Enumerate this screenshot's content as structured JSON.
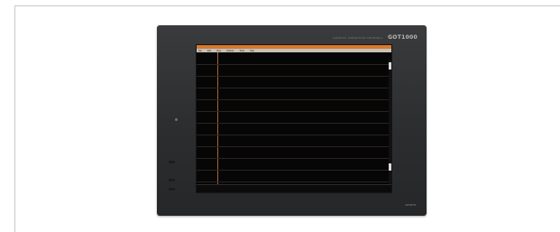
{
  "device": {
    "brand": "GOT1000",
    "brand_tag": "GRAPHIC OPERATION TERMINAL",
    "model": "GT1675"
  },
  "app": {
    "title_segments": [
      "",
      "",
      "",
      ""
    ],
    "menu": [
      "File",
      "Edit",
      "View",
      "Options",
      "Tools",
      "Help"
    ]
  },
  "screen": {
    "side_tag": "",
    "rows": [
      {
        "num": "",
        "tag": "",
        "v1": "",
        "v2": "",
        "v3": "",
        "v4": ""
      },
      {
        "num": "",
        "tag": "",
        "v1": "",
        "v2": "",
        "v3": "",
        "v4": ""
      },
      {
        "num": "",
        "tag": "",
        "v1": "",
        "v2": "",
        "v3": "",
        "v4": ""
      },
      {
        "num": "",
        "tag": "",
        "v1": "",
        "v2": "",
        "v3": "",
        "v4": ""
      },
      {
        "num": "",
        "tag": "",
        "v1": "",
        "v2": "",
        "v3": "",
        "v4": ""
      },
      {
        "num": "",
        "tag": "",
        "v1": "",
        "v2": "",
        "v3": "",
        "v4": ""
      },
      {
        "num": "",
        "tag": "",
        "v1": "",
        "v2": "",
        "v3": "",
        "v4": ""
      },
      {
        "num": "",
        "tag": "",
        "v1": "",
        "v2": "",
        "v3": "",
        "v4": ""
      },
      {
        "num": "",
        "tag": "",
        "v1": "",
        "v2": "",
        "v3": "",
        "v4": ""
      },
      {
        "num": "",
        "tag": "",
        "v1": "",
        "v2": "",
        "v3": "",
        "v4": ""
      },
      {
        "num": "",
        "tag": "",
        "v1": "",
        "v2": "",
        "v3": "",
        "v4": ""
      }
    ]
  },
  "colors": {
    "bezel": "#2f3032",
    "title_bar": "#d8782c",
    "rail": "#a8643a",
    "screen_bg": "#060606"
  }
}
